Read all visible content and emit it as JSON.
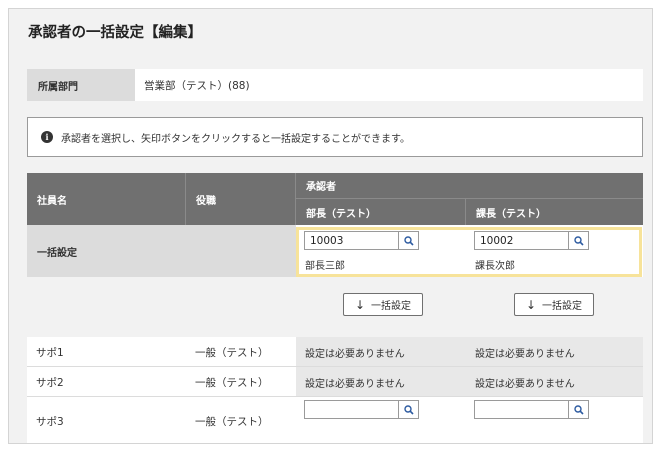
{
  "page": {
    "title": "承認者の一括設定【編集】"
  },
  "department": {
    "label": "所属部門",
    "value": "営業部（テスト）(88)"
  },
  "info": {
    "message": "承認者を選択し、矢印ボタンをクリックすると一括設定することができます。"
  },
  "table": {
    "headers": {
      "employee": "社員名",
      "role": "役職",
      "approver_group": "承認者",
      "approver1": "部長（テスト）",
      "approver2": "課長（テスト）"
    },
    "bulk": {
      "label": "一括設定",
      "approver1": {
        "code": "10003",
        "name": "部長三郎"
      },
      "approver2": {
        "code": "10002",
        "name": "課長次郎"
      },
      "button_label": "一括設定"
    },
    "rows": [
      {
        "name": "サポ1",
        "role": "一般（テスト）",
        "approver1": "設定は必要ありません",
        "approver2": "設定は必要ありません"
      },
      {
        "name": "サポ2",
        "role": "一般（テスト）",
        "approver1": "設定は必要ありません",
        "approver2": "設定は必要ありません"
      },
      {
        "name": "サポ3",
        "role": "一般（テスト）",
        "approver1": "",
        "approver2": ""
      }
    ]
  }
}
